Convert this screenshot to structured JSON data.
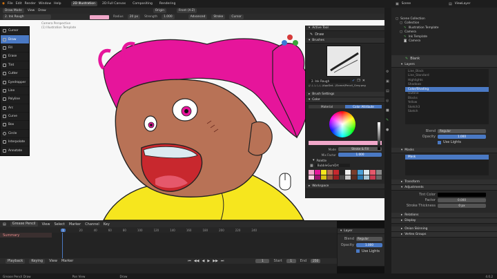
{
  "menu": {
    "items": [
      "File",
      "Edit",
      "Render",
      "Window",
      "Help"
    ],
    "tabs": [
      "2D Illustration",
      "2D Full Canvas",
      "Compositing",
      "Rendering"
    ],
    "active_tab": "2D Illustration"
  },
  "header": {
    "mode": "Draw Mode",
    "view": "View",
    "draw": "Draw",
    "origin": "Origin",
    "front": "Front (X-Z)"
  },
  "header2": {
    "brush": "2. Ink Rough",
    "radius_label": "Radius",
    "radius_value": "20 px",
    "strength_label": "Strength",
    "strength_value": "1.000",
    "advanced": "Advanced",
    "stroke": "Stroke",
    "cursor": "Cursor"
  },
  "viewport": {
    "view_name": "Camera Perspective",
    "object_name": "(1) Illustration Template"
  },
  "toolbar": {
    "tools": [
      "Cursor",
      "Draw",
      "Fill",
      "Erase",
      "Tint",
      "Cutter",
      "Eyedropper",
      "Line",
      "Polyline",
      "Arc",
      "Curve",
      "Box",
      "Circle",
      "Interpolate",
      "Annotate"
    ],
    "active": "Draw"
  },
  "n_panel": {
    "active_tool": "Active Tool",
    "tool_name": "Draw",
    "brushes": "Brushes",
    "brush_name": "2. Ink Rough",
    "brush_path": "//..\\..\\..\\..\\..\\AppDat...\\Scene\\Pencil_Grey.png",
    "brush_settings": "Brush Settings",
    "color": "Color",
    "material_tab": "Material",
    "attribute_tab": "Color Attribute",
    "mode_label": "Mode",
    "mode_value": "Stroke & Fill",
    "mix_label": "Mix Factor",
    "mix_value": "1.000",
    "palette_label": "Palette",
    "palette_value": "BubbleGumDrt",
    "workspace": "Workspace"
  },
  "outliner": {
    "title": "Scene",
    "viewlayer": "ViewLayer",
    "items": [
      "Scene Collection",
      "Collection",
      "Illustration Template",
      "Camera",
      "Ink Template",
      "Camera"
    ]
  },
  "props": {
    "object": "Blank",
    "layers_title": "Layers",
    "layer_items": [
      "Line_Black",
      "Line_Standard",
      "Highlights",
      "Shadows",
      "Color/Shading",
      "Outline",
      "Blocks",
      "Yellow",
      "Sketch3",
      "Sketch"
    ],
    "active_layer": "Color/Shading",
    "blend_label": "Blend",
    "blend_value": "Regular",
    "opacity_label": "Opacity",
    "opacity_value": "1.000",
    "use_lights": "Use Lights",
    "masks": "Masks",
    "mask_item": "Mask",
    "transform": "Transform",
    "adjustments": "Adjustments",
    "tint_color": "Tint Color",
    "factor_label": "Factor",
    "factor_value": "0.000",
    "stroke_thickness": "Stroke Thickness",
    "thickness_value": "0 px",
    "relations": "Relations",
    "display": "Display",
    "onion": "Onion Skinning",
    "vertex_groups": "Vertex Groups",
    "version": "4.0.2"
  },
  "timeline": {
    "editor": "Grease Pencil",
    "view": "View",
    "select": "Select",
    "marker": "Marker",
    "channel": "Channel",
    "key": "Key",
    "layer_row": "Summary",
    "frame_numbers": [
      "1",
      "20",
      "40",
      "60",
      "80",
      "100",
      "120",
      "140",
      "160",
      "180",
      "200",
      "220",
      "240"
    ],
    "current_frame": "1",
    "playback": "Playback",
    "keying": "Keying",
    "view2": "View",
    "marker2": "Marker",
    "start_label": "Start",
    "start_value": "1",
    "end_label": "End",
    "end_value": "250"
  },
  "layer_panel": {
    "title": "Layer",
    "blend_label": "Blend",
    "blend_value": "Regular",
    "opacity_label": "Opacity",
    "opacity_value": "1.000",
    "use_lights": "Use Lights"
  },
  "status": {
    "left": "Grease Pencil Draw",
    "mid": "Pan View",
    "right": "Draw"
  },
  "colors": {
    "accent": "#4a79c4",
    "hair": "#e6159b",
    "yellow": "#f6e61e",
    "skin": "#b87256"
  }
}
